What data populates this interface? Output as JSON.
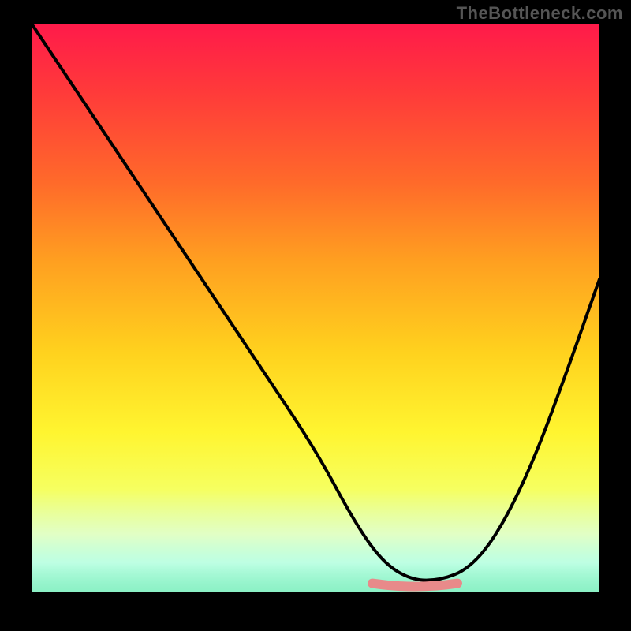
{
  "watermark": "TheBottleneck.com",
  "chart_data": {
    "type": "line",
    "title": "",
    "xlabel": "",
    "ylabel": "",
    "xlim": [
      0,
      100
    ],
    "ylim": [
      0,
      100
    ],
    "grid": false,
    "series": [
      {
        "name": "bottleneck-curve",
        "x": [
          0,
          10,
          20,
          30,
          40,
          50,
          57,
          62,
          67,
          72,
          77,
          82,
          88,
          94,
          100
        ],
        "y_pct": [
          100,
          85,
          70,
          55,
          40,
          25,
          12,
          5,
          2,
          2,
          4,
          10,
          22,
          38,
          55
        ]
      }
    ],
    "annotations": [
      {
        "name": "valley-marker",
        "x_start": 60,
        "x_end": 75,
        "y_pct": 2
      }
    ],
    "background": {
      "gradient_stops": [
        {
          "pos": 0,
          "color": "#ff1a4a"
        },
        {
          "pos": 28,
          "color": "#ff6a2a"
        },
        {
          "pos": 58,
          "color": "#ffd21e"
        },
        {
          "pos": 82,
          "color": "#f6ff60"
        },
        {
          "pos": 100,
          "color": "#00e080"
        }
      ]
    }
  }
}
